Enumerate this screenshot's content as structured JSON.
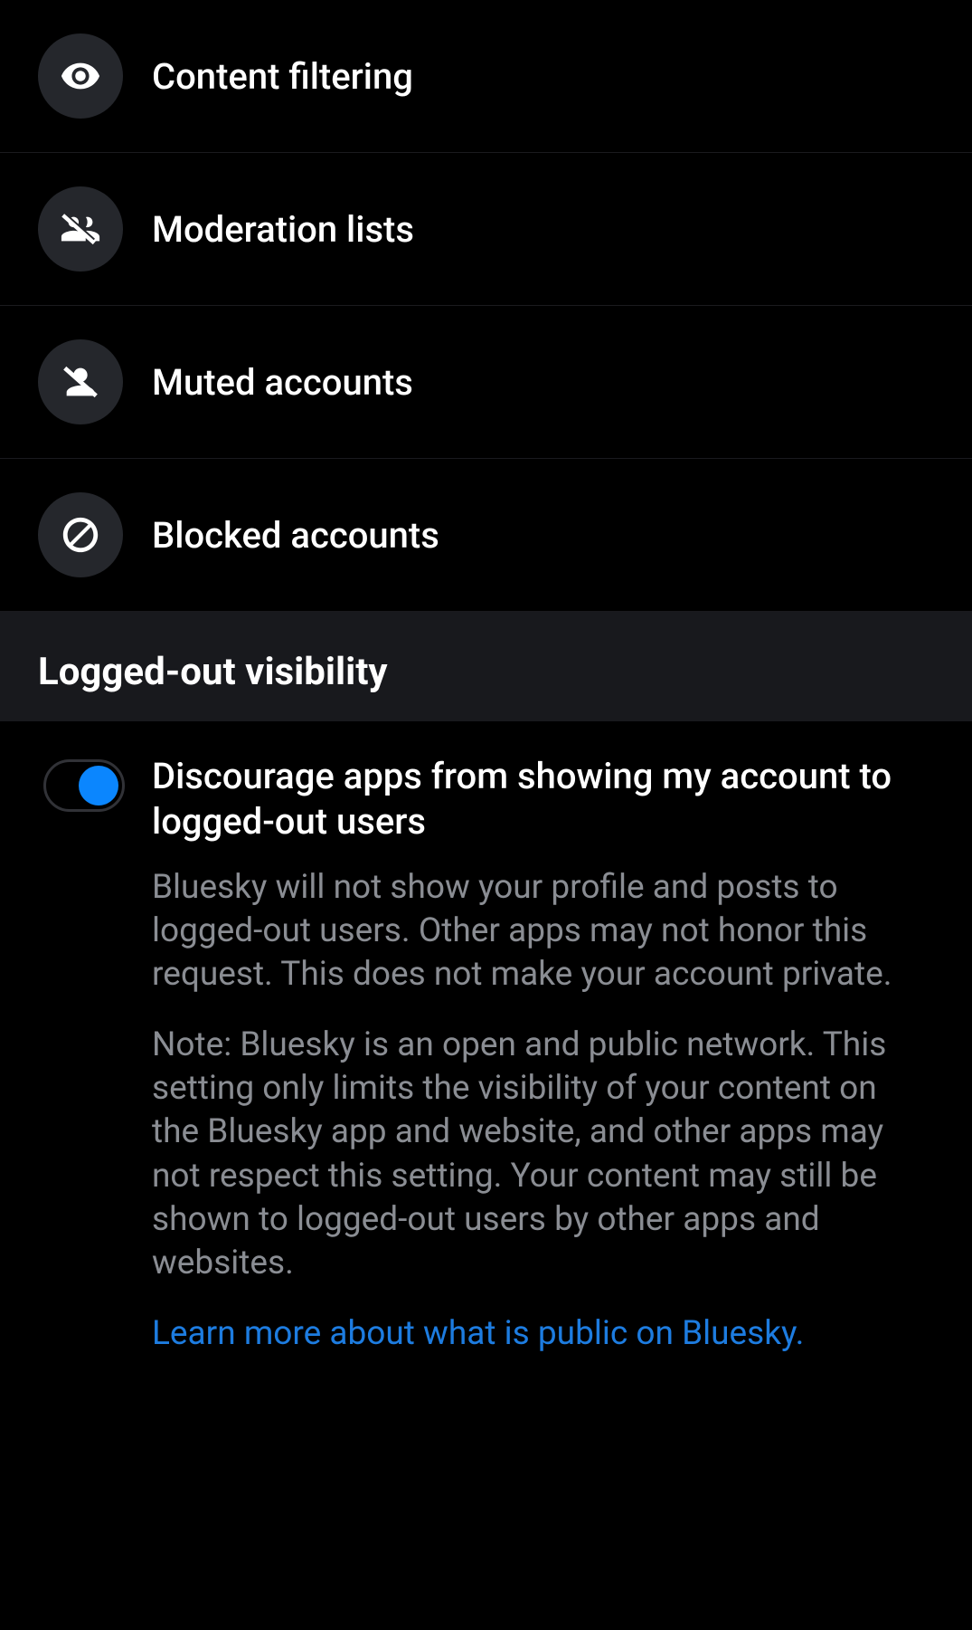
{
  "menu": [
    {
      "label": "Content filtering"
    },
    {
      "label": "Moderation lists"
    },
    {
      "label": "Muted accounts"
    },
    {
      "label": "Blocked accounts"
    }
  ],
  "section": {
    "title": "Logged-out visibility"
  },
  "setting": {
    "title": "Discourage apps from showing my account to logged-out users",
    "desc1": "Bluesky will not show your profile and posts to logged-out users. Other apps may not honor this request. This does not make your account private.",
    "desc2": "Note: Bluesky is an open and public network. This setting only limits the visibility of your content on the Bluesky app and website, and other apps may not respect this setting. Your content may still be shown to logged-out users by other apps and websites.",
    "link": "Learn more about what is public on Bluesky.",
    "toggle_on": true
  }
}
